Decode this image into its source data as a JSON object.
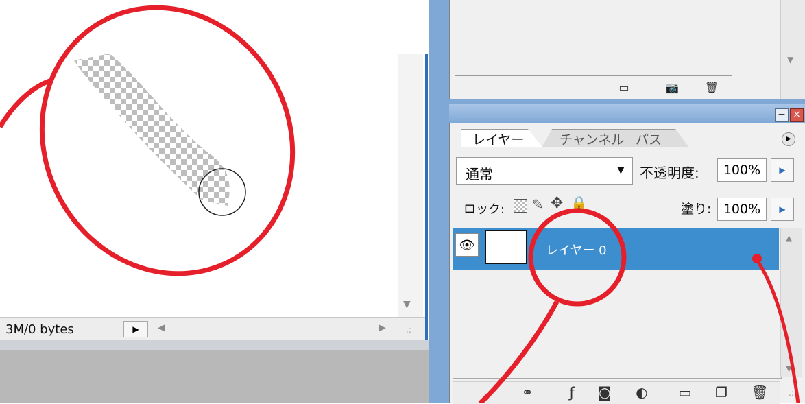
{
  "document_window": {
    "status_text": "3M/0 bytes",
    "status_arrow": "▶",
    "scroll_left": "◀",
    "scroll_right": "▶",
    "scroll_down": "▼",
    "grip": ".:"
  },
  "history_panel": {
    "icons": [
      "new-document-icon",
      "camera-icon",
      "trash-icon"
    ],
    "icon_glyphs": [
      "▭",
      "📷",
      "🗑"
    ],
    "scroll_arrow": "▼"
  },
  "layers_panel": {
    "window_controls": {
      "minimize": "−",
      "close": "×"
    },
    "tabs": [
      {
        "label": "レイヤー",
        "active": true
      },
      {
        "label": "チャンネル",
        "active": false
      },
      {
        "label": "パス",
        "active": false
      }
    ],
    "menu_button": "▶",
    "blend_mode": {
      "value": "通常",
      "arrow": "▼"
    },
    "opacity": {
      "label": "不透明度:",
      "value": "100%",
      "button": "▶"
    },
    "lock": {
      "label": "ロック:",
      "icons": [
        "lock-transparent-icon",
        "lock-brush-icon",
        "lock-move-icon",
        "lock-all-icon"
      ],
      "brush_glyph": "✎",
      "move_glyph": "✥",
      "all_glyph": "🔒"
    },
    "fill": {
      "label": "塗り:",
      "value": "100%",
      "button": "▶"
    },
    "layers": [
      {
        "name": "レイヤー 0",
        "visible": true,
        "selected": true
      }
    ],
    "eye_glyph": "👁",
    "list_scroll_up": "▲",
    "list_scroll_down": "▼",
    "bottom_icons": [
      "link-layers-icon",
      "layer-style-icon",
      "layer-mask-icon",
      "adjustment-layer-icon",
      "new-group-icon",
      "new-layer-icon",
      "delete-layer-icon"
    ],
    "bottom_glyphs": [
      "⚭",
      "ƒ",
      "◙",
      "◐",
      "▭",
      "❐",
      "🗑"
    ],
    "grip": ".:"
  },
  "colors": {
    "annotation_red": "#e5202a",
    "selected_layer": "#3d8ecf",
    "panel_blue": "#7fa8d6",
    "checker_gray": "#bdbdbd"
  }
}
